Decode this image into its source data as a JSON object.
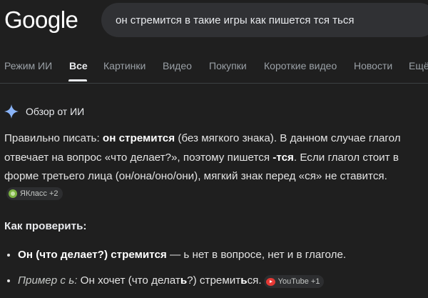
{
  "header": {
    "logo": "Google",
    "search_query": "он стремится в такие игры как пишется тся ться"
  },
  "tabs": [
    {
      "label": "Режим ИИ",
      "active": false
    },
    {
      "label": "Все",
      "active": true
    },
    {
      "label": "Картинки",
      "active": false
    },
    {
      "label": "Видео",
      "active": false
    },
    {
      "label": "Покупки",
      "active": false
    },
    {
      "label": "Короткие видео",
      "active": false
    },
    {
      "label": "Новости",
      "active": false
    },
    {
      "label": "Ещё",
      "active": false
    }
  ],
  "ai_overview": {
    "header": "Обзор от ИИ",
    "p1_a": "Правильно писать: ",
    "p1_b": "он стремится",
    "p1_c": " (без мягкого знака). В данном случае глагол отвечает на вопрос «что делает?», поэтому пишется ",
    "p1_d": "-тся",
    "p1_e": ". Если глагол стоит в форме третьего лица (он/она/оно/они), мягкий знак перед «ся» не ставится.",
    "chip1": "ЯКласс +2",
    "section_title": "Как проверить:",
    "b1_bold": "Он (что делает?) стремится",
    "b1_text": " — ь нет в вопросе, нет и в глаголе.",
    "b2_italic": "Пример с ь:",
    "b2_a": " Он хочет (что делат",
    "b2_b": "ь",
    "b2_c": "?) стремит",
    "b2_d": "ь",
    "b2_e": "ся.",
    "chip2": "YouTube +1"
  },
  "colors": {
    "background": "#1f1f1f",
    "search_box": "#303134",
    "text": "#e3e3e3",
    "muted": "#9aa0a6"
  }
}
